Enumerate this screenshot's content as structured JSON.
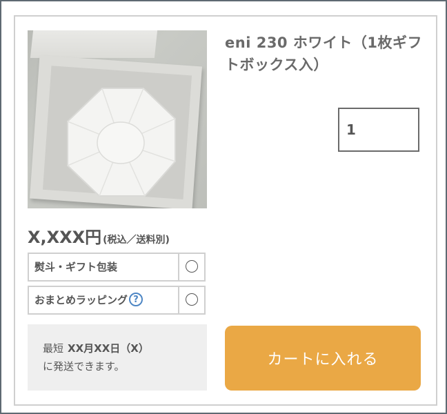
{
  "product": {
    "title": "eni 230 ホワイト（1枚ギフトボックス入）",
    "quantity": "1",
    "price": "X,XXX円",
    "price_note": "(税込／送料別)"
  },
  "options": [
    {
      "label": "熨斗・ギフト包装",
      "selected": false
    },
    {
      "label": "おまとめラッピング",
      "help_icon": "?",
      "selected": false
    }
  ],
  "shipping": {
    "prefix": "最短",
    "date": "XX月XX日（X）",
    "suffix": "に発送できます。"
  },
  "cart": {
    "button_label": "カートに入れる",
    "button_color": "#eaa845"
  }
}
